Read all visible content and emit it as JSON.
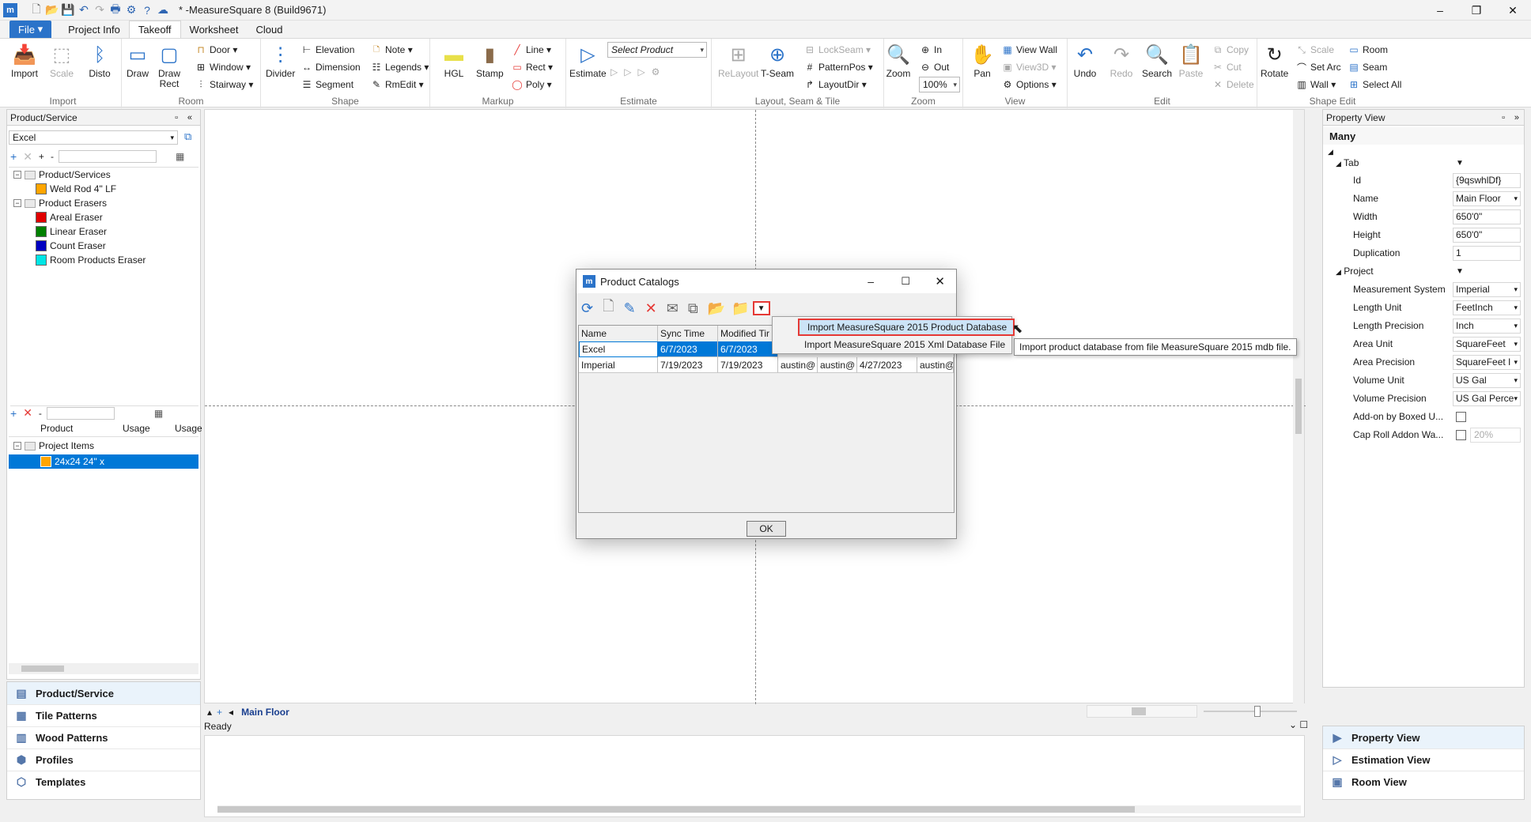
{
  "app": {
    "title": "* -MeasureSquare 8 (Build9671)"
  },
  "menu": {
    "file": "File",
    "tabs": [
      "Project Info",
      "Takeoff",
      "Worksheet",
      "Cloud"
    ]
  },
  "ribbon": {
    "import": {
      "import": "Import",
      "scale": "Scale",
      "disto": "Disto",
      "group": "Import"
    },
    "room": {
      "draw": "Draw",
      "draw_rect": "Draw\nRect",
      "door": "Door",
      "window": "Window",
      "stairway": "Stairway",
      "group": "Room"
    },
    "shape": {
      "divider": "Divider",
      "elevation": "Elevation",
      "dimension": "Dimension",
      "segment": "Segment",
      "note": "Note",
      "legends": "Legends",
      "rmedit": "RmEdit",
      "group": "Shape"
    },
    "markup": {
      "hgl": "HGL",
      "stamp": "Stamp",
      "line": "Line",
      "rect": "Rect",
      "poly": "Poly",
      "group": "Markup"
    },
    "estimate": {
      "estimate": "Estimate",
      "select_product": "Select Product",
      "group": "Estimate"
    },
    "layout": {
      "relayout": "ReLayout",
      "tseam": "T-Seam",
      "lockseam": "LockSeam",
      "patternpos": "PatternPos",
      "layoutdir": "LayoutDir",
      "group": "Layout, Seam & Tile"
    },
    "zoom": {
      "zoom": "Zoom",
      "in": "In",
      "out": "Out",
      "level": "100%",
      "group": "Zoom"
    },
    "view": {
      "pan": "Pan",
      "view_wall": "View Wall",
      "view3d": "View3D",
      "options": "Options",
      "group": "View"
    },
    "edit": {
      "undo": "Undo",
      "redo": "Redo",
      "search": "Search",
      "paste": "Paste",
      "copy": "Copy",
      "cut": "Cut",
      "delete": "Delete",
      "group": "Edit"
    },
    "shape_edit": {
      "rotate": "Rotate",
      "scale": "Scale",
      "set_arc": "Set Arc",
      "wall": "Wall",
      "room": "Room",
      "seam": "Seam",
      "select_all": "Select All",
      "group": "Shape Edit"
    }
  },
  "left_panel": {
    "title": "Product/Service",
    "catalog": "Excel",
    "tree": [
      {
        "label": "Product/Services",
        "type": "folder"
      },
      {
        "label": "Weld Rod 4\" LF",
        "color": "#ffa500"
      },
      {
        "label": "Product Erasers",
        "type": "folder"
      },
      {
        "label": "Areal Eraser",
        "color": "#e00000"
      },
      {
        "label": "Linear Eraser",
        "color": "#008000"
      },
      {
        "label": "Count Eraser",
        "color": "#0000c0"
      },
      {
        "label": "Room Products Eraser",
        "color": "#00e5e5"
      }
    ],
    "usage_headers": [
      "Product",
      "Usage",
      "Usage"
    ],
    "project_items": "Project Items",
    "selected_item": "24x24 24\" x",
    "nav": [
      "Product/Service",
      "Tile Patterns",
      "Wood Patterns",
      "Profiles",
      "Templates"
    ]
  },
  "canvas": {
    "floor_tab": "Main Floor",
    "status": "Ready"
  },
  "property_view": {
    "title": "Property View",
    "header": "Many",
    "tab_category": "Tab",
    "project_category": "Project",
    "rows_tab": [
      {
        "key": "Id",
        "value": "{9qswhlDf}"
      },
      {
        "key": "Name",
        "value": "Main Floor",
        "dd": true
      },
      {
        "key": "Width",
        "value": "650'0\""
      },
      {
        "key": "Height",
        "value": "650'0\""
      },
      {
        "key": "Duplication",
        "value": "1"
      }
    ],
    "rows_project": [
      {
        "key": "Measurement System",
        "value": "Imperial",
        "dd": true
      },
      {
        "key": "Length Unit",
        "value": "FeetInch",
        "dd": true
      },
      {
        "key": "Length Precision",
        "value": "Inch",
        "dd": true
      },
      {
        "key": "Area Unit",
        "value": "SquareFeet",
        "dd": true
      },
      {
        "key": "Area Precision",
        "value": "SquareFeet I",
        "dd": true
      },
      {
        "key": "Volume Unit",
        "value": "US Gal",
        "dd": true
      },
      {
        "key": "Volume Precision",
        "value": "US Gal Perce",
        "dd": true
      },
      {
        "key": "Add-on by Boxed U...",
        "value": ""
      },
      {
        "key": "Cap Roll Addon Wa...",
        "value": "20%"
      }
    ],
    "nav": [
      "Property View",
      "Estimation View",
      "Room View"
    ]
  },
  "dialog": {
    "title": "Product Catalogs",
    "columns": [
      "Name",
      "Sync Time",
      "Modified Tir"
    ],
    "rows": [
      [
        "Excel",
        "6/7/2023",
        "6/7/2023"
      ],
      [
        "Imperial",
        "7/19/2023",
        "7/19/2023",
        "austin@",
        "austin@",
        "4/27/2023",
        "austin@"
      ]
    ],
    "ok": "OK"
  },
  "dropdown": {
    "items": [
      "Import MeasureSquare 2015 Product Database",
      "Import MeasureSquare 2015 Xml Database File"
    ]
  },
  "tooltip": "Import product database from file MeasureSquare 2015 mdb file.",
  "colors": {
    "accent": "#2b73c9",
    "highlight_red": "#e53935",
    "selection": "#0078d7"
  }
}
